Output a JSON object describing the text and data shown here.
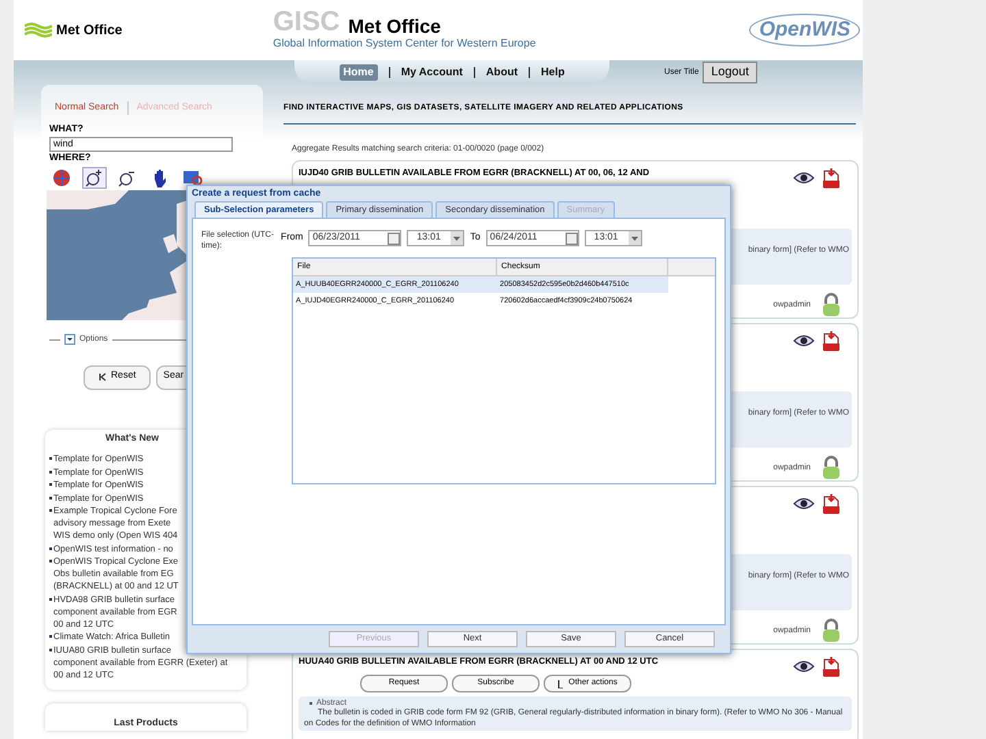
{
  "header": {
    "logo": "Met Office",
    "title_gisc": "GISC",
    "title_main": "Met Office",
    "subtitle": "Global Information System Center for Western Europe",
    "brand": "OpenWIS"
  },
  "nav": {
    "items": [
      {
        "label": "Home",
        "selected": true
      },
      {
        "label": "My Account",
        "selected": false
      },
      {
        "label": "About",
        "selected": false
      },
      {
        "label": "Help",
        "selected": false
      }
    ],
    "user": "User Title",
    "logout": "Logout"
  },
  "search": {
    "tabs": [
      {
        "label": "Normal Search",
        "selected": true
      },
      {
        "label": "Advanced Search",
        "selected": false
      }
    ],
    "what_label": "WHAT?",
    "what_value": "wind",
    "where_label": "WHERE?",
    "map_tools": [
      {
        "kind": "globe",
        "selected": false
      },
      {
        "kind": "zoom-in",
        "selected": true
      },
      {
        "kind": "zoom-out",
        "selected": false
      },
      {
        "kind": "hand",
        "selected": false
      },
      {
        "kind": "layers",
        "selected": false
      }
    ],
    "options": "Options",
    "buttons": [
      "Reset",
      "Sear"
    ]
  },
  "whats_new": {
    "title": "What's New",
    "items": [
      {
        "lines": [
          "Template for OpenWIS"
        ]
      },
      {
        "lines": [
          "Template for OpenWIS"
        ]
      },
      {
        "lines": [
          "Template for OpenWIS"
        ]
      },
      {
        "lines": [
          "Template for OpenWIS"
        ]
      },
      {
        "lines": [
          "Example Tropical Cyclone Fore",
          "advisory message from Exete",
          "WIS demo only (Open WIS 404"
        ]
      },
      {
        "lines": [
          "OpenWIS test information - no"
        ]
      },
      {
        "lines": [
          "OpenWIS Tropical Cyclone Exe",
          "Obs bulletin available from EG",
          "(BRACKNELL) at 00 and 12 UT"
        ]
      },
      {
        "lines": [
          "HVDA98 GRIB bulletin surface",
          "component available from EGR",
          "00 and 12 UTC"
        ]
      },
      {
        "lines": [
          "Climate Watch: Africa Bulletin"
        ]
      },
      {
        "lines": [
          "IUUA80 GRIB bulletin surface",
          "component available from EGRR (Exeter) at",
          "00 and 12 UTC"
        ]
      }
    ]
  },
  "last_products": {
    "title": "Last Products"
  },
  "results": {
    "heading": "FIND INTERACTIVE MAPS, GIS DATASETS, SATELLITE IMAGERY AND RELATED APPLICATIONS",
    "summary": "Aggregate Results matching search criteria: 01-00/0020 (page 0/002)",
    "items": [
      {
        "title": "IUJD40 GRIB BULLETIN AVAILABLE FROM EGRR (BRACKNELL) AT 00, 06, 12 AND",
        "abstract_tail": "binary form] (Refer to WMO",
        "owner": "owpadmin"
      },
      {
        "abstract_tail": "binary form] (Refer to WMO",
        "owner": "owpadmin"
      },
      {
        "abstract_tail": "binary form] (Refer to WMO",
        "owner": "owpadmin"
      },
      {
        "title": "HUUA40 GRIB BULLETIN AVAILABLE FROM EGRR (BRACKNELL) AT 00 AND 12 UTC",
        "actions": [
          "Request",
          "Subscribe",
          "Other actions"
        ],
        "abstract_label": "Abstract",
        "abstract": "The bulletin is coded in GRIB code form FM 92 (GRIB, General regularly-distributed information in binary form). (Refer to WMO No 306 - Manual on Codes for the definition of WMO Information"
      }
    ]
  },
  "dialog": {
    "title": "Create a request from cache",
    "tabs": [
      {
        "label": "Sub-Selection parameters",
        "selected": true,
        "disabled": false
      },
      {
        "label": "Primary dissemination",
        "selected": false,
        "disabled": false
      },
      {
        "label": "Secondary dissemination",
        "selected": false,
        "disabled": false
      },
      {
        "label": "Summary",
        "selected": false,
        "disabled": true
      }
    ],
    "file_label": "File selection (UTC-time):",
    "from_label": "From",
    "from_date": "06/23/2011",
    "from_time": "13:01",
    "to_label": "To",
    "to_date": "06/24/2011",
    "to_time": "13:01",
    "columns": [
      "File",
      "Checksum"
    ],
    "rows": [
      {
        "file": "A_HUUB40EGRR240000_C_EGRR_201106240",
        "checksum": "205083452d2c595e0b2d460b447510c",
        "selected": true
      },
      {
        "file": "A_IUJD40EGRR240000_C_EGRR_201106240",
        "checksum": "720602d6accaedf4cf3909c24b0750624",
        "selected": false
      }
    ],
    "buttons": [
      {
        "label": "Previous",
        "disabled": true
      },
      {
        "label": "Next",
        "disabled": false
      },
      {
        "label": "Save",
        "disabled": false
      },
      {
        "label": "Cancel",
        "disabled": false
      }
    ]
  }
}
